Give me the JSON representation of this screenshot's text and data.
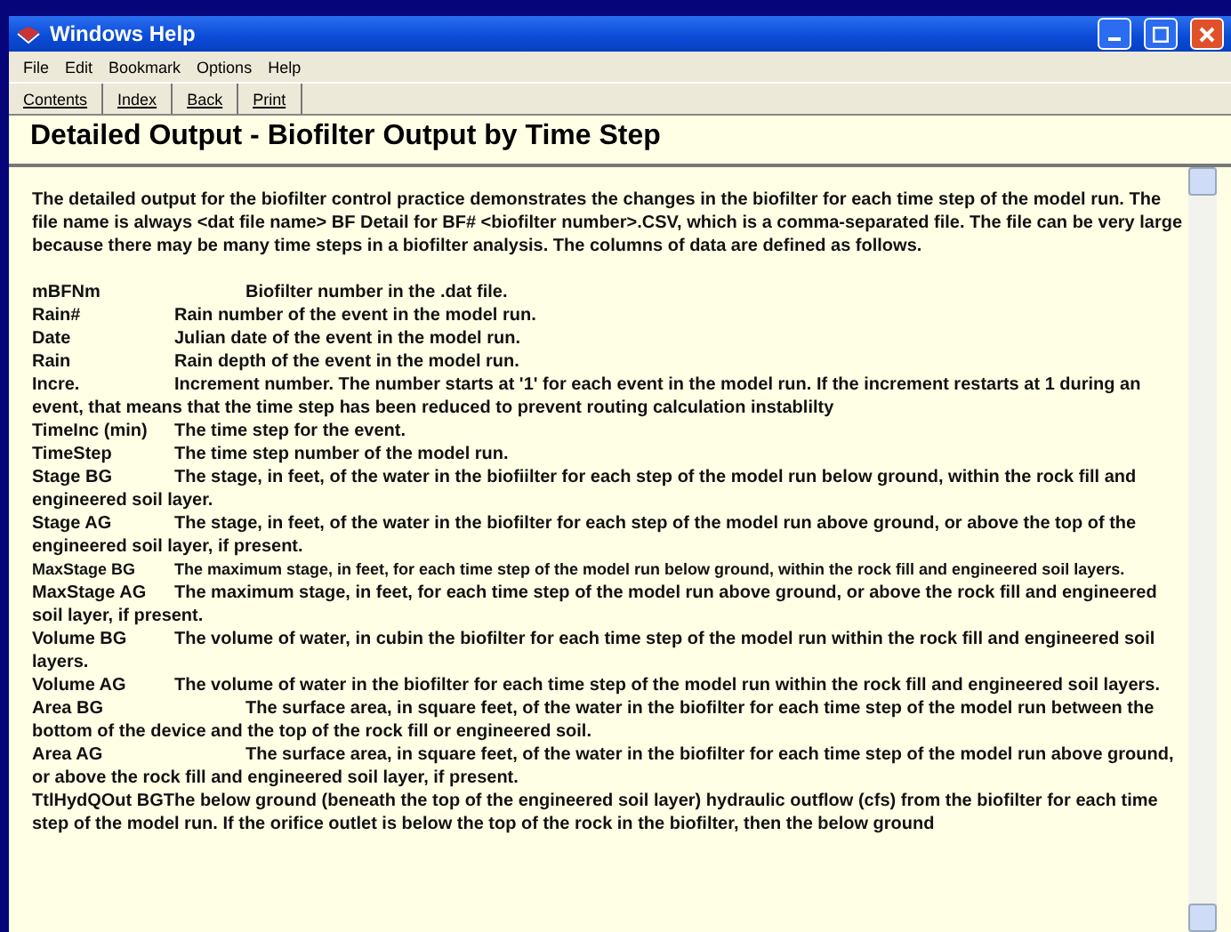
{
  "window": {
    "title": "Windows Help"
  },
  "menu": [
    "File",
    "Edit",
    "Bookmark",
    "Options",
    "Help"
  ],
  "toolbar": [
    "Contents",
    "Index",
    "Back",
    "Print"
  ],
  "topic_title": "Detailed Output - Biofilter Output by Time Step",
  "intro": "The detailed output for the biofilter control practice demonstrates the changes in the biofilter for each time step of the model run. The file name is always <dat file name> BF Detail for BF# <biofilter number>.CSV, which is a comma-separated file.  The file can be very large because there may be many time steps in a biofilter analysis.  The columns of data are defined as follows.",
  "definitions": [
    {
      "kind": "wide",
      "term": "mBFNm",
      "text": "Biofilter number in the .dat file."
    },
    {
      "kind": "normal",
      "term": "Rain#",
      "text": "Rain number of the event in the model run."
    },
    {
      "kind": "normal",
      "term": "Date",
      "text": "Julian date of the event in the model run."
    },
    {
      "kind": "normal",
      "term": "Rain",
      "text": "Rain depth of the event in the model run."
    },
    {
      "kind": "normal",
      "term": "Incre.",
      "text": "Increment number.  The number starts at '1' for each event in the model run.  If the increment restarts at 1 during an event, that means that the time step has been reduced to prevent routing calculation instablilty"
    },
    {
      "kind": "normal",
      "term": "TimeInc (min)",
      "text": "The time step for the event."
    },
    {
      "kind": "normal",
      "term": "TimeStep",
      "text": "The time step number of the model run."
    },
    {
      "kind": "normal",
      "term": "Stage BG",
      "text": "The stage, in feet, of the water in the biofiilter for each step of the model run below ground, within the rock fill and engineered soil layer."
    },
    {
      "kind": "normal",
      "term": "Stage AG",
      "text": "The stage, in feet, of the water in the biofilter for each step of the model run above ground, or above the top of the engineered soil layer, if present."
    },
    {
      "kind": "small",
      "term": "MaxStage BG",
      "text": "The maximum stage, in feet, for each time step of the model run below ground, within the rock fill and engineered soil layers."
    },
    {
      "kind": "normal",
      "term": "MaxStage AG",
      "text": "The maximum stage, in feet, for each time step of the model run above ground, or above the rock fill and engineered soil layer, if present."
    },
    {
      "kind": "normal",
      "term": "Volume BG",
      "text": "The volume of water, in cubin the biofilter for each time step of the model run within the rock fill and engineered soil layers."
    },
    {
      "kind": "normal",
      "term": "Volume AG",
      "text": "The volume of water in the biofilter for each time step of the model run within the rock fill and engineered soil layers."
    },
    {
      "kind": "wide",
      "term": "Area BG",
      "text": "The surface area, in square feet,  of the water in the biofilter for each time step of the model run between the bottom of the device and the top of the rock fill or engineered soil."
    },
    {
      "kind": "wide",
      "term": "Area AG",
      "text": "The surface area, in square feet,  of the water in the biofilter for each time step of the model run above ground, or above the rock fill and engineered soil layer, if present."
    },
    {
      "kind": "tight",
      "term": "TtlHydQOut BG",
      "text": "The below ground (beneath the top of the engineered soil layer) hydraulic outflow (cfs) from the biofilter for each time step of the model run.  If the orifice outlet is below the top of the rock in the biofilter, then the below ground"
    }
  ]
}
